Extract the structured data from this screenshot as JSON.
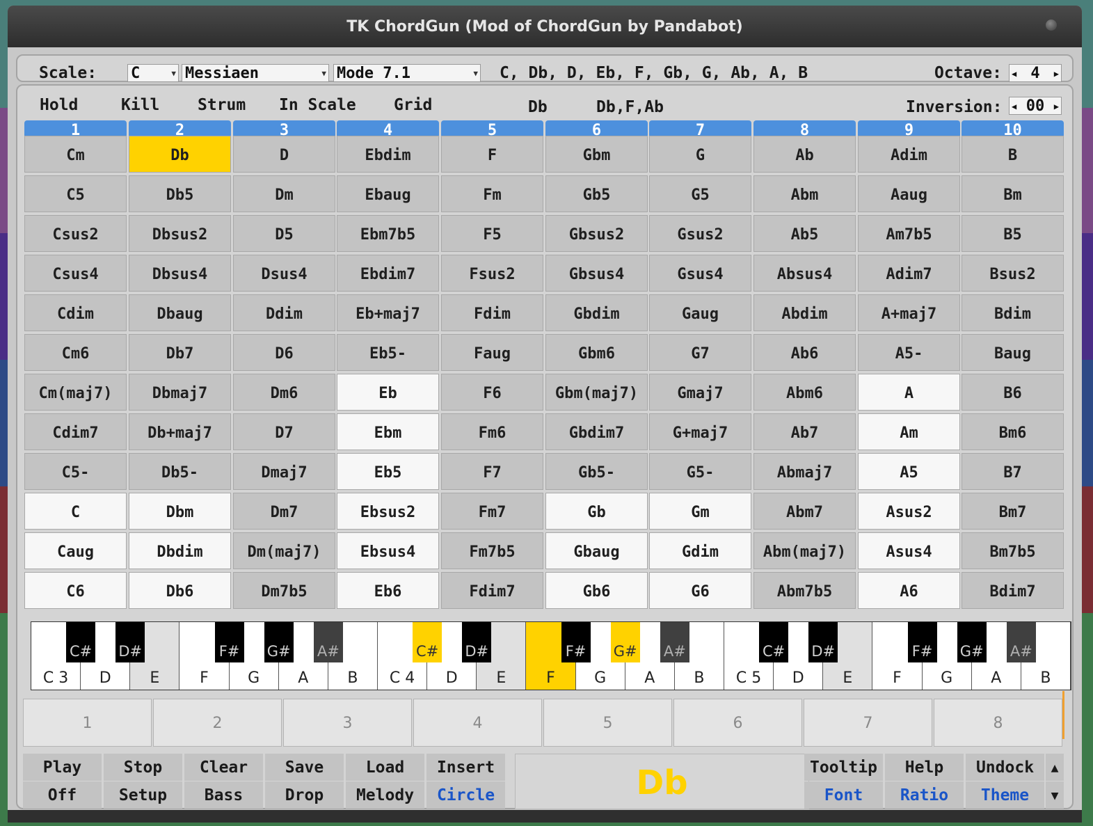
{
  "window": {
    "title": "TK ChordGun (Mod of ChordGun by Pandabot)"
  },
  "scale_bar": {
    "scale_label": "Scale:",
    "root": "C",
    "scale_type": "Messiaen",
    "mode": "Mode 7.1",
    "notes": "C, Db, D, Eb, F, Gb, G, Ab, A, B",
    "octave_label": "Octave:",
    "octave_value": "4"
  },
  "controls": {
    "hold": "Hold",
    "kill": "Kill",
    "strum": "Strum",
    "in_scale": "In Scale",
    "grid": "Grid",
    "current_chord": "Db",
    "current_notes": "Db,F,Ab",
    "inversion_label": "Inversion:",
    "inversion_value": "00"
  },
  "columns": [
    "1",
    "2",
    "3",
    "4",
    "5",
    "6",
    "7",
    "8",
    "9",
    "10"
  ],
  "grid": [
    [
      "Cm",
      "Db",
      "D",
      "Ebdim",
      "F",
      "Gbm",
      "G",
      "Ab",
      "Adim",
      "B"
    ],
    [
      "C5",
      "Db5",
      "Dm",
      "Ebaug",
      "Fm",
      "Gb5",
      "G5",
      "Abm",
      "Aaug",
      "Bm"
    ],
    [
      "Csus2",
      "Dbsus2",
      "D5",
      "Ebm7b5",
      "F5",
      "Gbsus2",
      "Gsus2",
      "Ab5",
      "Am7b5",
      "B5"
    ],
    [
      "Csus4",
      "Dbsus4",
      "Dsus4",
      "Ebdim7",
      "Fsus2",
      "Gbsus4",
      "Gsus4",
      "Absus4",
      "Adim7",
      "Bsus2"
    ],
    [
      "Cdim",
      "Dbaug",
      "Ddim",
      "Eb+maj7",
      "Fdim",
      "Gbdim",
      "Gaug",
      "Abdim",
      "A+maj7",
      "Bdim"
    ],
    [
      "Cm6",
      "Db7",
      "D6",
      "Eb5-",
      "Faug",
      "Gbm6",
      "G7",
      "Ab6",
      "A5-",
      "Baug"
    ],
    [
      "Cm(maj7)",
      "Dbmaj7",
      "Dm6",
      "Eb",
      "F6",
      "Gbm(maj7)",
      "Gmaj7",
      "Abm6",
      "A",
      "B6"
    ],
    [
      "Cdim7",
      "Db+maj7",
      "D7",
      "Ebm",
      "Fm6",
      "Gbdim7",
      "G+maj7",
      "Ab7",
      "Am",
      "Bm6"
    ],
    [
      "C5-",
      "Db5-",
      "Dmaj7",
      "Eb5",
      "F7",
      "Gb5-",
      "G5-",
      "Abmaj7",
      "A5",
      "B7"
    ],
    [
      "C",
      "Dbm",
      "Dm7",
      "Ebsus2",
      "Fm7",
      "Gb",
      "Gm",
      "Abm7",
      "Asus2",
      "Bm7"
    ],
    [
      "Caug",
      "Dbdim",
      "Dm(maj7)",
      "Ebsus4",
      "Fm7b5",
      "Gbaug",
      "Gdim",
      "Abm(maj7)",
      "Asus4",
      "Bm7b5"
    ],
    [
      "C6",
      "Db6",
      "Dm7b5",
      "Eb6",
      "Fdim7",
      "Gb6",
      "G6",
      "Abm7b5",
      "A6",
      "Bdim7"
    ]
  ],
  "grid_states": [
    "gyggggggggg",
    "gggggggggg",
    "gggggggggg",
    "gggggggggg",
    "gggggggggg",
    "gggggggggg",
    "gggwgggggwg",
    "gggwgggggwg",
    "gggwgggggwg",
    "wwgwgwwgggg",
    "wwgwgwwgggg",
    "wwgwgwwgggg"
  ],
  "piano": {
    "white_labels": [
      "C 3",
      "D",
      "E",
      "F",
      "G",
      "A",
      "B",
      "C 4",
      "D",
      "E",
      "F",
      "G",
      "A",
      "B",
      "C 5",
      "D",
      "E",
      "F",
      "G",
      "A",
      "B"
    ],
    "black_labels": [
      "C#",
      "D#",
      "F#",
      "G#",
      "A#",
      "C#",
      "D#",
      "F#",
      "G#",
      "A#",
      "C#",
      "D#",
      "F#",
      "G#",
      "A#"
    ],
    "highlight_color": "#ffd200"
  },
  "slots": [
    "1",
    "2",
    "3",
    "4",
    "5",
    "6",
    "7",
    "8"
  ],
  "buttons": {
    "play": "Play",
    "off": "Off",
    "stop": "Stop",
    "setup": "Setup",
    "clear": "Clear",
    "bass": "Bass",
    "save": "Save",
    "drop": "Drop",
    "load": "Load",
    "melody": "Melody",
    "insert": "Insert",
    "circle": "Circle",
    "tooltip": "Tooltip",
    "font": "Font",
    "help": "Help",
    "ratio": "Ratio",
    "undock": "Undock",
    "theme": "Theme",
    "scroll_up": "▲",
    "scroll_down": "▼"
  },
  "chord_display": "Db",
  "colors": {
    "header_blue": "#4d90dd",
    "highlight": "#ffd200",
    "link_blue": "#1a55c8"
  }
}
